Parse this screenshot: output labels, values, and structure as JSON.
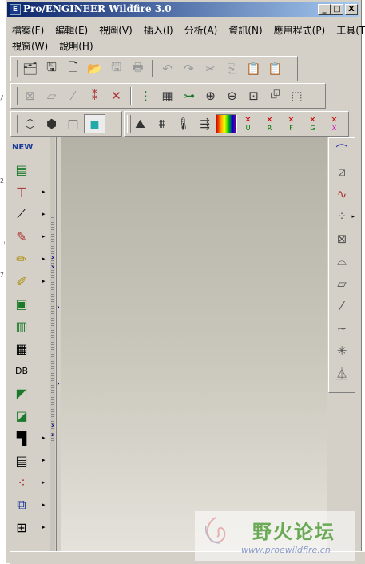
{
  "window": {
    "title": "Pro/ENGINEER Wildfire 3.0",
    "app_icon": "E",
    "minimize": "_",
    "maximize": "□",
    "close": "X"
  },
  "menu": {
    "row1": [
      "檔案(F)",
      "編輯(E)",
      "視圖(V)",
      "插入(I)",
      "分析(A)",
      "資訊(N)",
      "應用程式(P)",
      "工具(T)"
    ],
    "row2": [
      "視窗(W)",
      "說明(H)"
    ]
  },
  "toolbar1": {
    "icons": [
      "open-folder-check-icon",
      "save-copy-icon",
      "new-file-icon",
      "open-icon",
      "save-icon",
      "print-icon",
      "undo-icon",
      "redo-icon",
      "cut-icon",
      "copy-icon",
      "paste-icon",
      "paste-special-icon"
    ]
  },
  "toolbar2": {
    "icons": [
      "datum-plane-off-icon",
      "datum-plane-display-icon",
      "datum-axis-display-icon",
      "datum-point-display-icon",
      "coord-sys-display-icon",
      "model-tree-icon",
      "layer-icon",
      "network-icon",
      "zoom-in-icon",
      "zoom-out-icon",
      "refit-icon",
      "orient-icon",
      "saved-views-icon"
    ]
  },
  "toolbar3": {
    "icons": [
      "wireframe-icon",
      "hidden-line-icon",
      "no-hidden-icon",
      "shading-icon",
      "mold-analysis-icon",
      "mesh-icon",
      "probe-icon",
      "parting-icon",
      "color-bars-icon"
    ],
    "letters": [
      "U",
      "R",
      "F",
      "G",
      "X"
    ]
  },
  "left_tools": [
    "new-mold-icon",
    "mold-base-icon",
    "refpart-icon",
    "workpiece-icon",
    "shrink-icon",
    "parting-surface-icon",
    "split-icon",
    "volume-icon",
    "extract-icon",
    "casting-icon",
    "mold-db-icon",
    "runner-icon",
    "waterline-icon",
    "ejector-icon",
    "insert-icon",
    "mold-open-icon",
    "check-icon",
    "layout-icon",
    "assemble-icon"
  ],
  "right_tools": [
    "sketch-icon",
    "plane-icon",
    "curve-icon",
    "point-icon",
    "point-sketch-icon",
    "curve-sketch-icon",
    "plane2-icon",
    "axis-icon",
    "spline-icon",
    "csys-icon",
    "analysis-feature-icon"
  ],
  "watermark": {
    "text": "野火论坛",
    "url": "www.proewildfire.cn"
  },
  "colors": {
    "title_start": "#0a246a",
    "title_end": "#a6caf0",
    "workspace": "#c8c6ba",
    "chrome": "#d4d0c8"
  }
}
